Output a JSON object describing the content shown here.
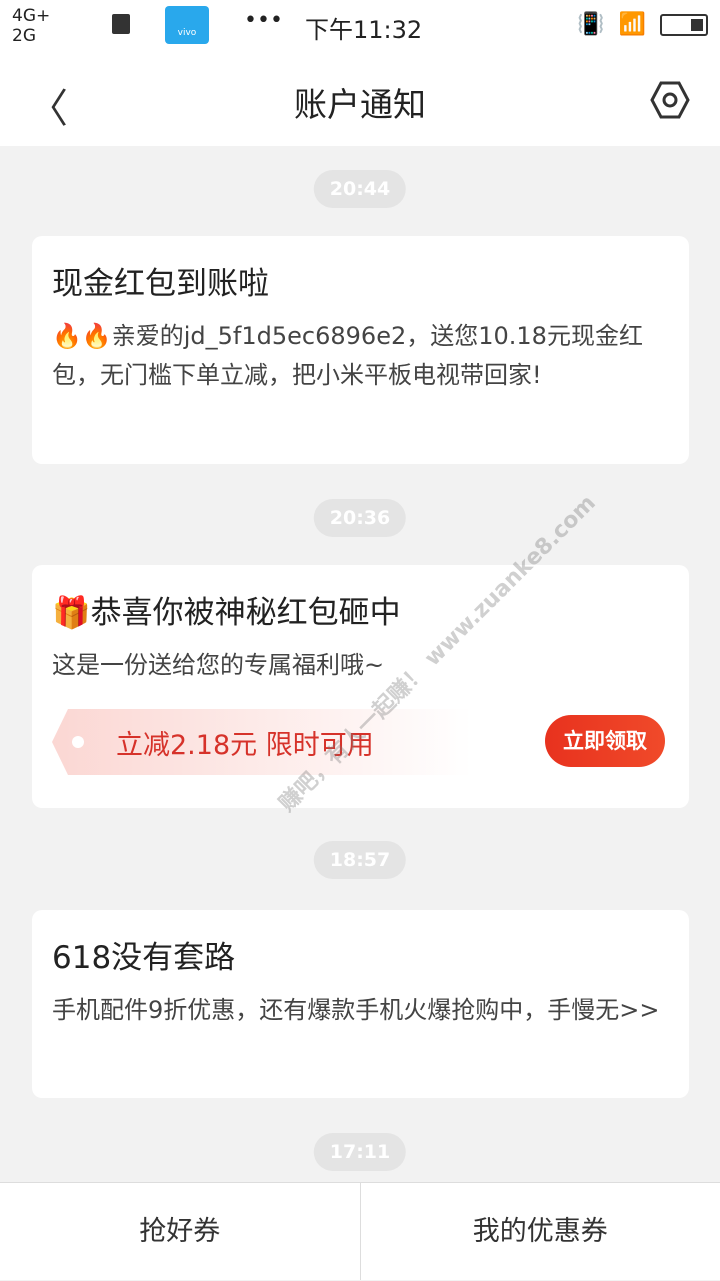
{
  "status_bar": {
    "network_top": "4G+",
    "network_bottom": "2G",
    "time": "下午11:32",
    "dots": "•••",
    "vivo_label": "vivo"
  },
  "header": {
    "title": "账户通知"
  },
  "messages": [
    {
      "time": "20:44",
      "title": "现金红包到账啦",
      "body": "🔥🔥亲爱的jd_5f1d5ec6896e2，送您10.18元现金红包，无门槛下单立减，把小米平板电视带回家!"
    },
    {
      "time": "20:36",
      "title": "🎁恭喜你被神秘红包砸中",
      "body": "这是一份送给您的专属福利哦~",
      "coupon_text": "立减2.18元 限时可用",
      "coupon_button": "立即领取"
    },
    {
      "time": "18:57",
      "title": "618没有套路",
      "body": "手机配件9折优惠，还有爆款手机火爆抢购中，手慢无>>"
    },
    {
      "time": "17:11"
    }
  ],
  "footer": {
    "left": "抢好券",
    "right": "我的优惠券"
  },
  "watermark": "赚吧，有人一起赚！ www.zuanke8.com",
  "colors": {
    "accent": "#e8321e"
  }
}
